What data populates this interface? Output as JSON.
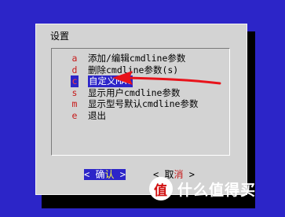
{
  "dialog": {
    "title": "设置"
  },
  "menu": {
    "items": [
      {
        "key": "a",
        "label": "添加/编辑cmdline参数",
        "selected": false
      },
      {
        "key": "d",
        "label": "删除cmdline参数(s)",
        "selected": false
      },
      {
        "key": "c",
        "label": "自定义MAC",
        "selected": true
      },
      {
        "key": "s",
        "label": "显示用户cmdline参数",
        "selected": false
      },
      {
        "key": "m",
        "label": "显示型号默认cmdline参数",
        "selected": false
      },
      {
        "key": "e",
        "label": "退出",
        "selected": false
      }
    ]
  },
  "buttons": {
    "ok": {
      "open": "<",
      "text": "确",
      "accel": "认",
      "close": ">"
    },
    "cancel": {
      "open": "<",
      "text": "取",
      "accel": "消",
      "close": ">"
    }
  },
  "annotation": {
    "arrow_color": "#e8131b"
  },
  "watermark": {
    "text": "什么值得买",
    "logo_glyph": "值"
  },
  "colors": {
    "background": "#2c25c8",
    "dialog": "#d3d3d3",
    "hotkey": "#c61a1a",
    "selection": "#2c25c8"
  }
}
